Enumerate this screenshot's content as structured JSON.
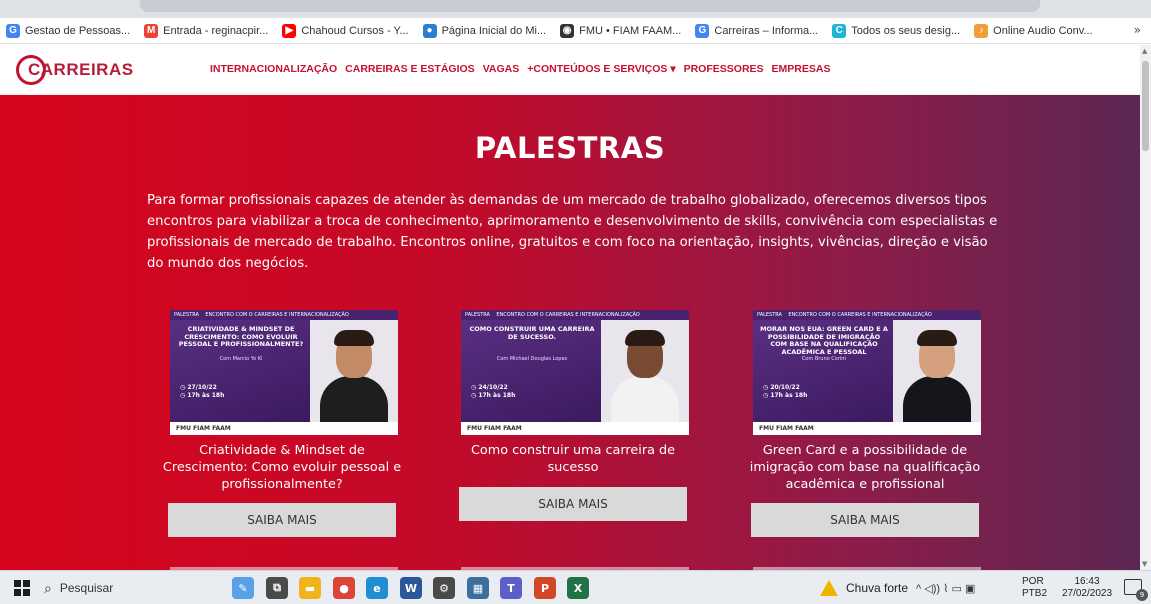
{
  "colors": {
    "brand_red": "#c8102e",
    "hero_start": "#d6051c",
    "hero_end": "#5c2752",
    "button_gray": "#d9d9d9"
  },
  "bookmarks": [
    {
      "label": "Gestao de Pessoas...",
      "icon": "google-icon",
      "color": "#4285f4",
      "glyph": "G"
    },
    {
      "label": "Entrada - reginacpir...",
      "icon": "gmail-icon",
      "color": "#ea4335",
      "glyph": "M"
    },
    {
      "label": "Chahoud Cursos - Y...",
      "icon": "youtube-icon",
      "color": "#ff0000",
      "glyph": "▶"
    },
    {
      "label": "Página Inicial do Mi...",
      "icon": "microsoft-icon",
      "color": "#2b7cd3",
      "glyph": "●"
    },
    {
      "label": "FMU • FIAM FAAM...",
      "icon": "globe-icon",
      "color": "#333333",
      "glyph": "◉"
    },
    {
      "label": "Carreiras – Informa...",
      "icon": "google-icon",
      "color": "#4285f4",
      "glyph": "G"
    },
    {
      "label": "Todos os seus desig...",
      "icon": "canva-icon",
      "color": "#1fb6d4",
      "glyph": "C"
    },
    {
      "label": "Online Audio Conv...",
      "icon": "audio-icon",
      "color": "#f29d38",
      "glyph": "♪"
    }
  ],
  "bookmarks_more": "»",
  "logo_text": "CARREIRAS",
  "nav": [
    "INTERNACIONALIZAÇÃO",
    "CARREIRAS E ESTÁGIOS",
    "VAGAS",
    "+CONTEÚDOS E SERVIÇOS ▾",
    "PROFESSORES",
    "EMPRESAS"
  ],
  "hero": {
    "title": "PALESTRAS",
    "description": "Para formar profissionais capazes de atender às demandas de um mercado de trabalho globalizado, oferecemos diversos tipos encontros para viabilizar a troca de conhecimento, aprimoramento e desenvolvimento de skills, convivência com especialistas e profissionais de mercado de trabalho. Encontros online, gratuitos e com foco na orientação, insights, vivências, direção e visão do mundo dos negócios."
  },
  "cards": [
    {
      "thumb_tag": "PALESTRA",
      "thumb_banner": "ENCONTRO COM O CARREIRAS E INTERNACIONALIZAÇÃO",
      "thumb_headline": "CRIATIVIDADE & MINDSET DE CRESCIMENTO: COMO EVOLUIR PESSOAL E PROFISSIONALMENTE?",
      "thumb_speaker": "Com Marcio Yo Ki",
      "thumb_date": "27/10/22",
      "thumb_time": "17h às 18h",
      "thumb_footer": "FMU FIAM FAAM",
      "title": "Criatividade & Mindset de Crescimento: Como evoluir pessoal e profissionalmente?",
      "button": "SAIBA MAIS",
      "shirt_color": "#1e1e1e",
      "skin_color": "#c28a66"
    },
    {
      "thumb_tag": "PALESTRA",
      "thumb_banner": "ENCONTRO COM O CARREIRAS E INTERNACIONALIZAÇÃO",
      "thumb_headline": "COMO CONSTRUIR UMA CARREIRA DE SUCESSO.",
      "thumb_speaker": "Com Michael Douglas Lopes",
      "thumb_date": "24/10/22",
      "thumb_time": "17h às 18h",
      "thumb_footer": "FMU FIAM FAAM",
      "title": "Como construir uma carreira de sucesso",
      "button": "SAIBA MAIS",
      "shirt_color": "#f2f2f2",
      "skin_color": "#7a4b33"
    },
    {
      "thumb_tag": "PALESTRA",
      "thumb_banner": "ENCONTRO COM O CARREIRAS E INTERNACIONALIZAÇÃO",
      "thumb_headline": "MORAR NOS EUA: GREEN CARD E A POSSIBILIDADE DE IMIGRAÇÃO COM BASE NA QUALIFICAÇÃO ACADÊMICA E PESSOAL",
      "thumb_speaker": "Com Bruno Corim",
      "thumb_date": "20/10/22",
      "thumb_time": "17h às 18h",
      "thumb_footer": "FMU FIAM FAAM",
      "title": "Green Card e a possibilidade de imigração com base na qualificação acadêmica e profissional",
      "button": "SAIBA MAIS",
      "shirt_color": "#15161c",
      "skin_color": "#d4a07e"
    }
  ],
  "taskbar": {
    "search_placeholder": "Pesquisar",
    "apps": [
      {
        "icon": "paint-icon",
        "color": "#5aa0e6",
        "glyph": "✎"
      },
      {
        "icon": "task-view-icon",
        "color": "#4a4a4a",
        "glyph": "⧉"
      },
      {
        "icon": "file-explorer-icon",
        "color": "#f2b21a",
        "glyph": "▬"
      },
      {
        "icon": "chrome-icon",
        "color": "#db4437",
        "glyph": "●"
      },
      {
        "icon": "edge-icon",
        "color": "#1f8fd1",
        "glyph": "e"
      },
      {
        "icon": "word-icon",
        "color": "#2b579a",
        "glyph": "W"
      },
      {
        "icon": "settings-icon",
        "color": "#4a4a4a",
        "glyph": "⚙"
      },
      {
        "icon": "calculator-icon",
        "color": "#3c6e9e",
        "glyph": "▦"
      },
      {
        "icon": "teams-icon",
        "color": "#5b5fc7",
        "glyph": "T"
      },
      {
        "icon": "powerpoint-icon",
        "color": "#d24726",
        "glyph": "P"
      },
      {
        "icon": "excel-icon",
        "color": "#217346",
        "glyph": "X"
      }
    ],
    "weather": "Chuva forte",
    "tray_symbols": "^ ◁)) ⌇ ▭ ▣",
    "lang_top": "POR",
    "lang_bottom": "PTB2",
    "time": "16:43",
    "date": "27/02/2023",
    "notif_count": "9"
  }
}
